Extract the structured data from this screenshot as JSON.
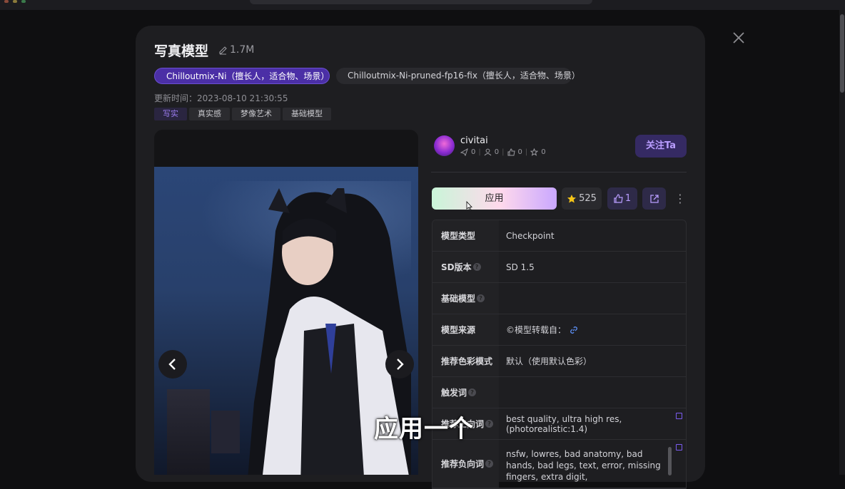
{
  "model": {
    "title": "写真模型",
    "size": "1.7M",
    "versions": [
      {
        "label": "Chilloutmix-Ni（擅长人，适合物、场景）",
        "active": true
      },
      {
        "label": "Chilloutmix-Ni-pruned-fp16-fix（擅长人，适合物、场景）",
        "active": false
      }
    ],
    "updated_label": "更新时间：2023-08-10 21:30:55",
    "tags": [
      "写实",
      "真实感",
      "梦像艺术",
      "基础模型"
    ]
  },
  "author": {
    "name": "civitai",
    "stats": [
      "0",
      "0",
      "0",
      "0"
    ],
    "follow_label": "关注Ta"
  },
  "actions": {
    "apply_label": "应用",
    "stars": "525",
    "likes": "1"
  },
  "info": {
    "rows": [
      {
        "label": "模型类型",
        "value": "Checkpoint"
      },
      {
        "label": "SD版本",
        "value": "SD 1.5"
      },
      {
        "label": "基础模型",
        "value": ""
      },
      {
        "label": "模型来源",
        "value": "©模型转载自："
      },
      {
        "label": "推荐色彩模式",
        "value": "默认（使用默认色彩）"
      },
      {
        "label": "触发词",
        "value": ""
      },
      {
        "label": "推荐正向词",
        "value": "best quality, ultra high res, (photorealistic:1.4)"
      },
      {
        "label": "推荐负向词",
        "value": "nsfw, lowres, bad anatomy, bad hands, bad legs, text, error, missing fingers, extra digit,"
      }
    ]
  },
  "caption": "应用一个",
  "colors": {
    "accent": "#4b2fa6",
    "accent_text": "#b99dff",
    "background": "#1e1e21"
  }
}
